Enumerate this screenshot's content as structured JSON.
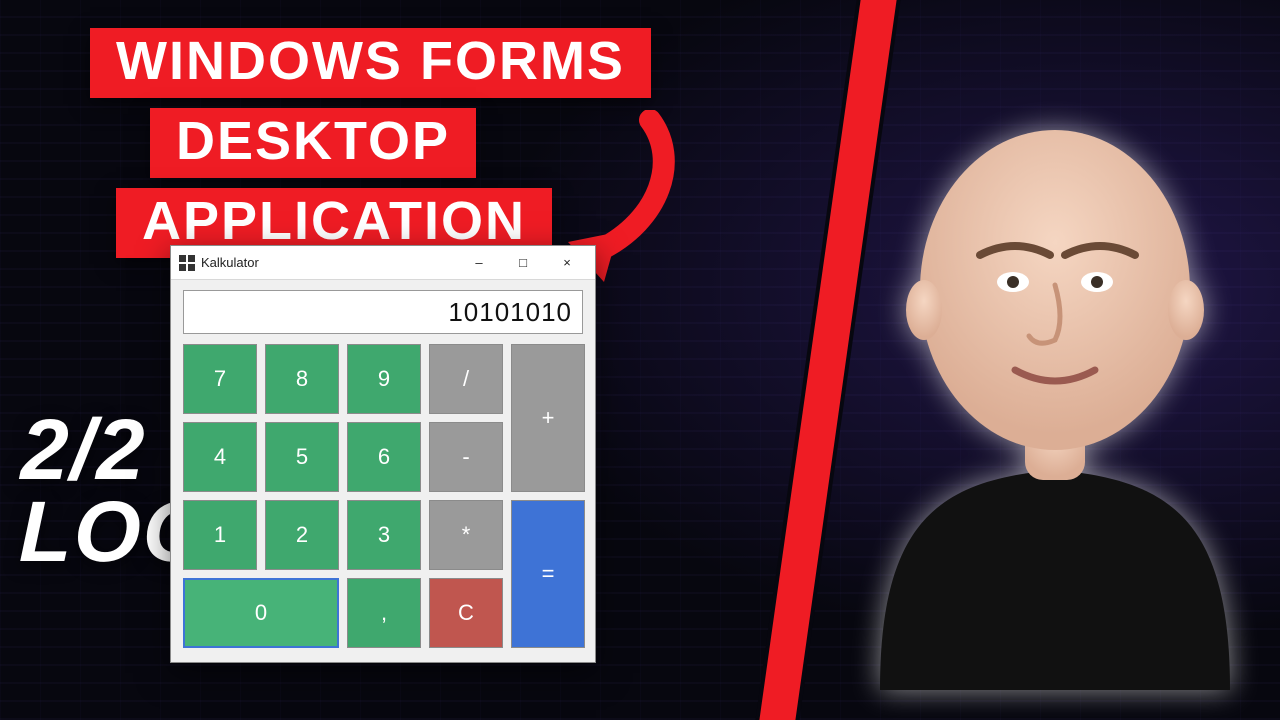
{
  "headline": {
    "line1": "WINDOWS FORMS",
    "line2": "DESKTOP",
    "line3": "APPLICATION"
  },
  "subtitle": {
    "line1": "2/2",
    "line2": "LOGIC"
  },
  "arrow": {
    "name": "curved-arrow-down-icon"
  },
  "calculator": {
    "window_title": "Kalkulator",
    "display_value": "10101010",
    "controls": {
      "minimize": "–",
      "maximize": "□",
      "close": "×"
    },
    "keys": {
      "n7": "7",
      "n8": "8",
      "n9": "9",
      "div": "/",
      "add": "+",
      "n4": "4",
      "n5": "5",
      "n6": "6",
      "sub": "-",
      "n1": "1",
      "n2": "2",
      "n3": "3",
      "mul": "*",
      "eq": "=",
      "n0": "0",
      "dec": ",",
      "clr": "C"
    }
  },
  "colors": {
    "accent_red": "#ef1c24",
    "num_green": "#3fa86e",
    "op_gray": "#9a9a9a",
    "clear_red": "#c0564f",
    "equals_blue": "#3e73d6"
  }
}
